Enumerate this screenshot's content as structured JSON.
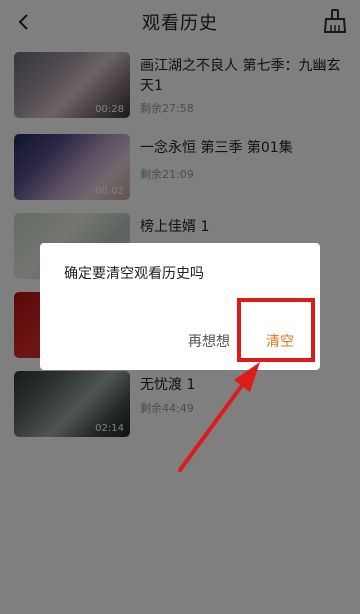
{
  "header": {
    "title": "观看历史",
    "back_icon": "back-arrow-icon",
    "clear_icon": "broom-icon"
  },
  "items": [
    {
      "title": "画江湖之不良人 第七季：九幽玄天1",
      "duration": "00:28",
      "remaining": "剩余27:58"
    },
    {
      "title": "一念永恒 第三季 第01集",
      "duration": "00:02",
      "remaining": "剩余21:09"
    },
    {
      "title": "榜上佳婿 1",
      "duration": "",
      "remaining": ""
    },
    {
      "title": "",
      "duration": "",
      "remaining": ""
    },
    {
      "title": "无忧渡 1",
      "duration": "02:14",
      "remaining": "剩余44:49"
    }
  ],
  "dialog": {
    "message": "确定要清空观看历史吗",
    "cancel_label": "再想想",
    "confirm_label": "清空"
  },
  "colors": {
    "accent": "#e8761a",
    "annotation": "#e0191b"
  }
}
